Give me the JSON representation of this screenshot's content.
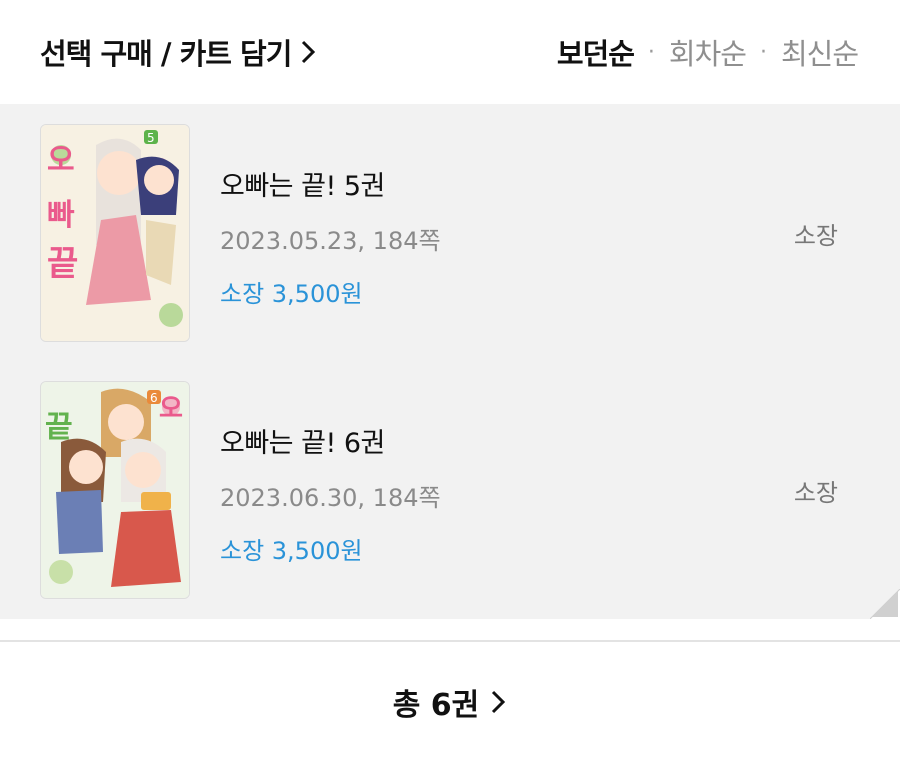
{
  "header": {
    "select_label": "선택 구매 / 카트 담기",
    "sort_options": [
      "보던순",
      "회차순",
      "최신순"
    ],
    "sort_active": "보던순"
  },
  "items": [
    {
      "title": "오빠는 끝! 5권",
      "meta": "2023.05.23, 184쪽",
      "price": "소장 3,500원",
      "status": "소장",
      "cover_label": "오빠는 끝! 5",
      "cover_badge": "5"
    },
    {
      "title": "오빠는 끝! 6권",
      "meta": "2023.06.30, 184쪽",
      "price": "소장 3,500원",
      "status": "소장",
      "cover_label": "오빠는 끝! 6",
      "cover_badge": "6"
    }
  ],
  "footer": {
    "total_label": "총 6권"
  },
  "colors": {
    "price_blue": "#2a93d8",
    "list_bg": "#f2f2f2"
  }
}
